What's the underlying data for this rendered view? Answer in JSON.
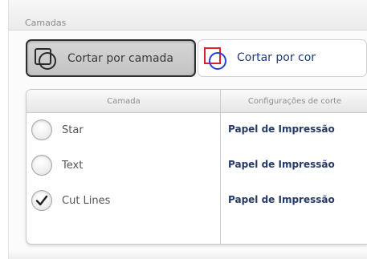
{
  "panel": {
    "title": "Camadas"
  },
  "modes": [
    {
      "label": "Cortar por camada",
      "icon": "cut-by-layer-icon",
      "selected": true
    },
    {
      "label": "Cortar por cor",
      "icon": "cut-by-color-icon",
      "selected": false
    }
  ],
  "table": {
    "columns": [
      "Camada",
      "Configurações de corte"
    ],
    "rows": [
      {
        "name": "Star",
        "config": "Papel de Impressão",
        "checked": false
      },
      {
        "name": "Text",
        "config": "Papel de Impressão",
        "checked": false
      },
      {
        "name": "Cut Lines",
        "config": "Papel de Impressão",
        "checked": true
      }
    ]
  },
  "colors": {
    "accent_text": "#243a6b",
    "icon_red": "#e0212b",
    "icon_blue": "#2340d8"
  }
}
